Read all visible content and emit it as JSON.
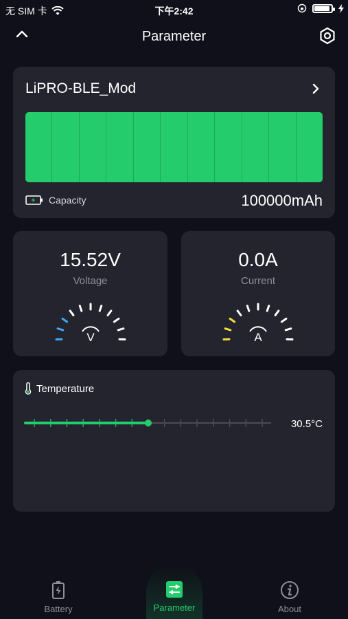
{
  "status": {
    "carrier": "无 SIM 卡",
    "time": "下午2:42"
  },
  "nav": {
    "title": "Parameter",
    "back_icon": "chevron-up-icon",
    "settings_icon": "gear-icon"
  },
  "device": {
    "name": "LiPRO-BLE_Mod",
    "cells_count": 11,
    "capacity_label": "Capacity",
    "capacity_value": "100000mAh"
  },
  "voltage": {
    "value": "15.52V",
    "label": "Voltage",
    "unit_symbol": "V",
    "accent": "#3fa9f5"
  },
  "current": {
    "value": "0.0A",
    "label": "Current",
    "unit_symbol": "A",
    "accent": "#f5e13f"
  },
  "temperature": {
    "title": "Temperature",
    "value": "30.5°C",
    "level_fraction": 0.5
  },
  "tabs": [
    {
      "label": "Battery",
      "icon": "battery-icon",
      "active": false
    },
    {
      "label": "Parameter",
      "icon": "parameter-icon",
      "active": true
    },
    {
      "label": "About",
      "icon": "info-icon",
      "active": false
    }
  ],
  "colors": {
    "accent": "#25cc6b",
    "background": "#0f1019",
    "card": "#23242e"
  }
}
